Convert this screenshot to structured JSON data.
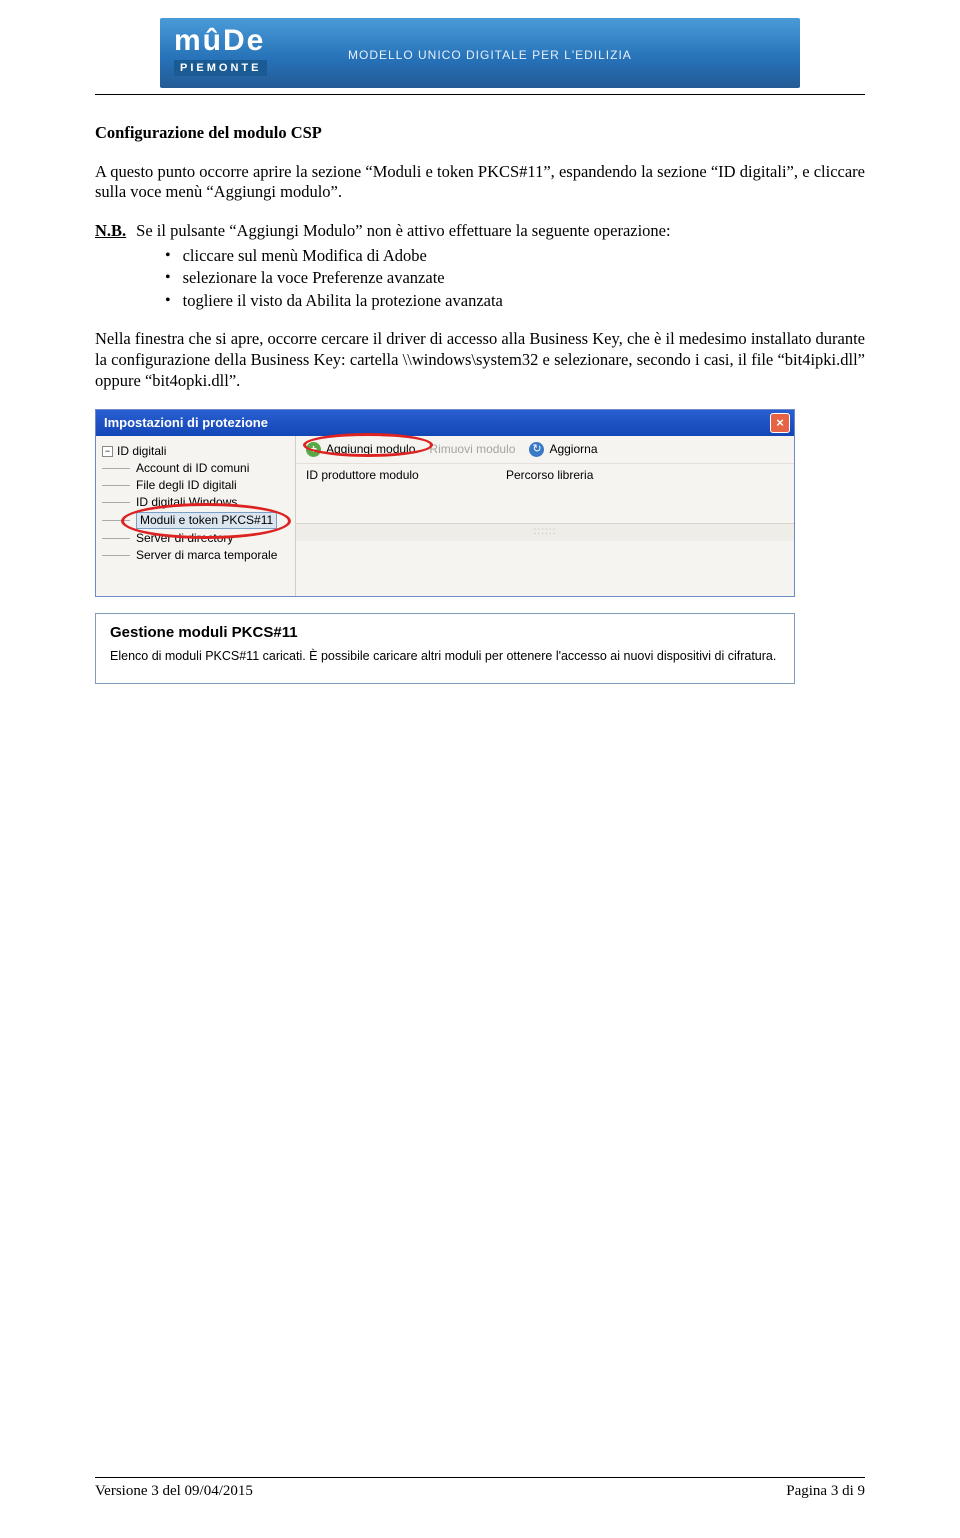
{
  "banner": {
    "logo_main": "mûDe",
    "logo_sub": "PIEMONTE",
    "tagline": "MODELLO UNICO DIGITALE PER L'EDILIZIA"
  },
  "doc": {
    "title": "Configurazione del modulo CSP",
    "para1": "A questo punto occorre aprire la sezione “Moduli e token PKCS#11”, espandendo la sezione “ID digitali”, e cliccare sulla voce menù “Aggiungi modulo”.",
    "nb_label": "N.B.",
    "nb_text": "Se il pulsante “Aggiungi Modulo” non è attivo effettuare la seguente operazione:",
    "bullets": [
      "cliccare sul menù Modifica di Adobe",
      "selezionare la voce Preferenze avanzate",
      "togliere il visto da Abilita la protezione avanzata"
    ],
    "para2": "Nella finestra che si apre, occorre cercare il driver di accesso alla Business Key, che è il medesimo installato durante la configurazione della Business Key: cartella \\\\windows\\system32 e selezionare, secondo i casi, il file “bit4ipki.dll” oppure “bit4opki.dll”."
  },
  "screenshot": {
    "window_title": "Impostazioni di protezione",
    "tree": {
      "root": "ID digitali",
      "items": [
        "Account di ID comuni",
        "File degli ID digitali",
        "ID digitali Windows",
        "Moduli e token PKCS#11",
        "Server di directory",
        "Server di marca temporale"
      ]
    },
    "toolbar": {
      "add": "Aggiungi modulo",
      "remove": "Rimuovi modulo",
      "refresh": "Aggiorna"
    },
    "columns": {
      "col1": "ID produttore modulo",
      "col2": "Percorso libreria"
    },
    "pkcs": {
      "title": "Gestione moduli PKCS#11",
      "desc": "Elenco di moduli PKCS#11 caricati. È possibile caricare altri moduli per ottenere l'accesso ai nuovi dispositivi di cifratura."
    }
  },
  "footer": {
    "version": "Versione 3 del 09/04/2015",
    "page": "Pagina 3 di 9"
  }
}
